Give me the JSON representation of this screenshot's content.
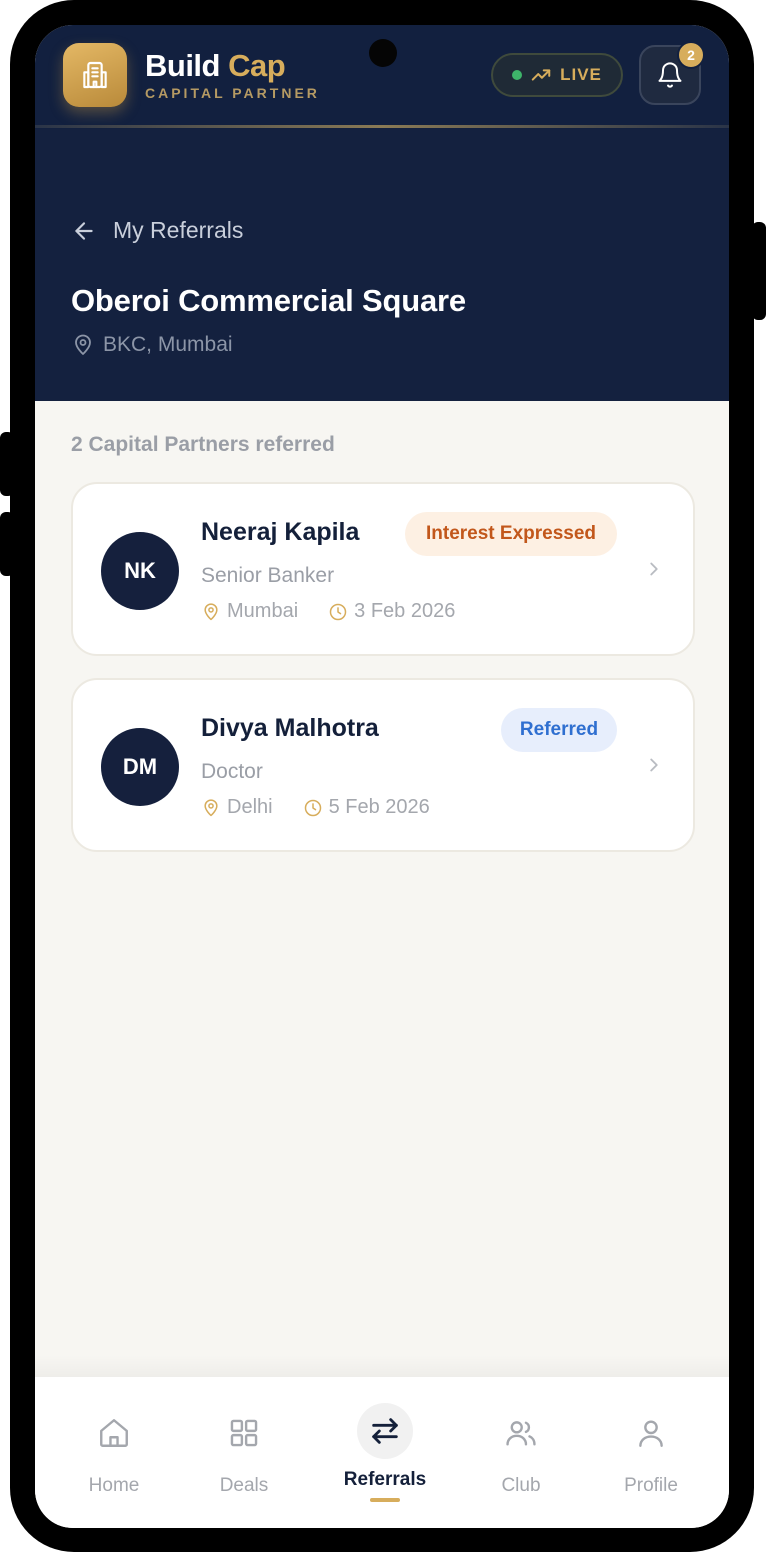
{
  "header": {
    "brand_first": "Build",
    "brand_second": "Cap",
    "brand_subtitle": "CAPITAL PARTNER",
    "live_label": "LIVE",
    "notification_count": "2"
  },
  "hero": {
    "back_label": "My Referrals",
    "title": "Oberoi Commercial Square",
    "location": "BKC, Mumbai"
  },
  "referrals": {
    "count_text": "2 Capital Partners referred",
    "items": [
      {
        "initials": "NK",
        "name": "Neeraj Kapila",
        "role": "Senior Banker",
        "city": "Mumbai",
        "date": "3 Feb 2026",
        "status": "Interest Expressed"
      },
      {
        "initials": "DM",
        "name": "Divya Malhotra",
        "role": "Doctor",
        "city": "Delhi",
        "date": "5 Feb 2026",
        "status": "Referred"
      }
    ]
  },
  "nav": {
    "items": [
      {
        "label": "Home",
        "icon": "home-icon"
      },
      {
        "label": "Deals",
        "icon": "grid-icon"
      },
      {
        "label": "Referrals",
        "icon": "swap-arrows-icon",
        "active": true
      },
      {
        "label": "Club",
        "icon": "users-icon"
      },
      {
        "label": "Profile",
        "icon": "user-icon"
      }
    ]
  },
  "colors": {
    "navy": "#14213f",
    "gold": "#d7ad5c",
    "status_orange": "#c2571b",
    "status_blue": "#2f6fd0"
  }
}
